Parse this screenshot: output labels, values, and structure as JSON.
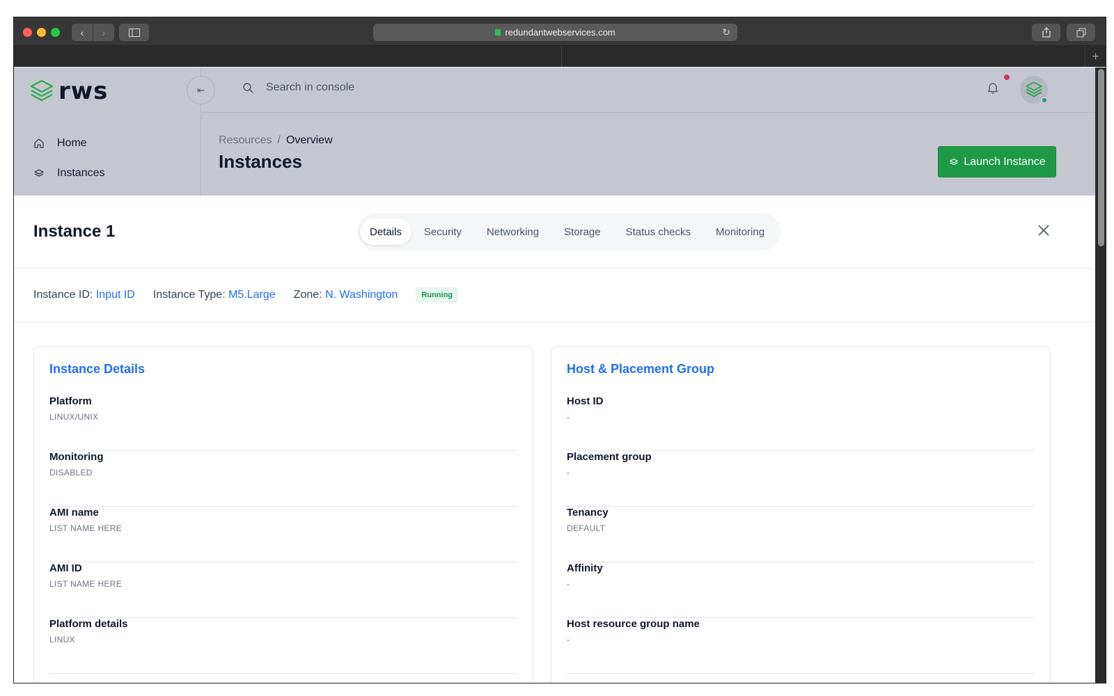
{
  "browser": {
    "url": "redundantwebservices.com"
  },
  "brand": {
    "name": "rws",
    "accent": "#1e9a46"
  },
  "topbar": {
    "search_placeholder": "Search in console"
  },
  "sidebar": {
    "items": [
      {
        "label": "Home",
        "icon": "home-icon"
      },
      {
        "label": "Instances",
        "icon": "layers-icon"
      }
    ]
  },
  "header": {
    "breadcrumb": [
      "Resources",
      "/",
      "Overview"
    ],
    "title": "Instances",
    "launch_label": "Launch Instance"
  },
  "panel": {
    "title": "Instance 1",
    "tabs": [
      "Details",
      "Security",
      "Networking",
      "Storage",
      "Status checks",
      "Monitoring"
    ],
    "active_tab": "Details",
    "meta": {
      "id_label": "Instance ID:",
      "id_value": "Input ID",
      "type_label": "Instance Type:",
      "type_value": "M5.Large",
      "zone_label": "Zone:",
      "zone_value": "N. Washington",
      "status": "Running"
    },
    "cards": [
      {
        "title": "Instance Details",
        "fields": [
          {
            "label": "Platform",
            "value": "LINUX/UNIX"
          },
          {
            "label": "Monitoring",
            "value": "DISABLED"
          },
          {
            "label": "AMI name",
            "value": "LIST NAME HERE"
          },
          {
            "label": "AMI ID",
            "value": "LIST NAME HERE"
          },
          {
            "label": "Platform details",
            "value": "LINUX"
          }
        ]
      },
      {
        "title": "Host & Placement Group",
        "fields": [
          {
            "label": "Host ID",
            "value": "-"
          },
          {
            "label": "Placement group",
            "value": "-"
          },
          {
            "label": "Tenancy",
            "value": "DEFAULT"
          },
          {
            "label": "Affinity",
            "value": "-"
          },
          {
            "label": "Host resource group name",
            "value": "-"
          }
        ]
      }
    ]
  }
}
